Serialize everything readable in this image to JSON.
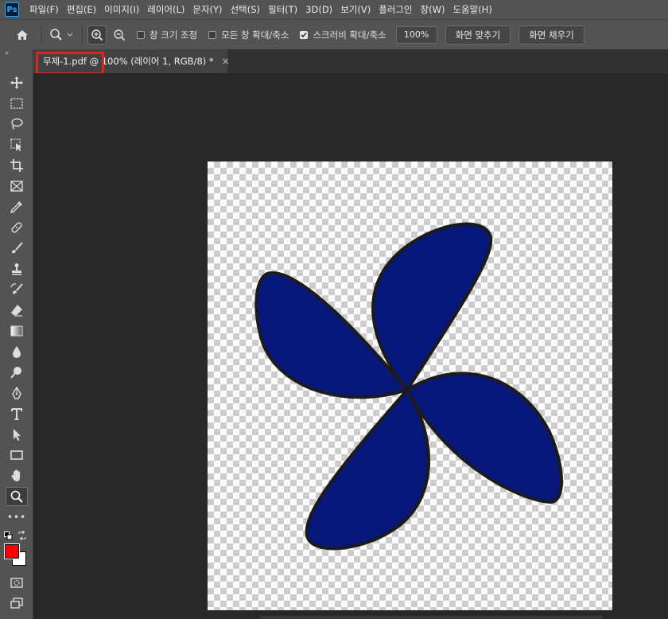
{
  "app": {
    "logo_text": "Ps"
  },
  "menu": [
    "파일(F)",
    "편집(E)",
    "이미지(I)",
    "레이어(L)",
    "문자(Y)",
    "선택(S)",
    "필터(T)",
    "3D(D)",
    "보기(V)",
    "플러그인",
    "창(W)",
    "도움말(H)"
  ],
  "options": {
    "resize_windows_label": "창 크기 조정",
    "zoom_all_windows_label": "모든 창 확대/축소",
    "scrubby_zoom_label": "스크러비 확대/축소",
    "scrubby_zoom_checked": true,
    "zoom_value": "100%",
    "fit_screen_label": "화면 맞추기",
    "fill_screen_label": "화면 채우기"
  },
  "document_tab": {
    "title": "무제-1.pdf @ 100% (레이어 1, RGB/8) *",
    "close_glyph": "×"
  },
  "toolbar": {
    "grip_glyph": "»",
    "more_glyph": "•••"
  },
  "colors": {
    "foreground": "#ff0000",
    "background": "#ffffff",
    "shape_fill": "#08187a",
    "highlight": "#e5231e"
  },
  "icons": [
    "home-icon",
    "zoom-tool-icon",
    "zoom-in-icon",
    "zoom-out-icon",
    "move-tool-icon",
    "marquee-tool-icon",
    "lasso-tool-icon",
    "object-select-tool-icon",
    "crop-tool-icon",
    "frame-tool-icon",
    "eyedropper-tool-icon",
    "healing-brush-icon",
    "brush-tool-icon",
    "clone-stamp-icon",
    "history-brush-icon",
    "eraser-tool-icon",
    "gradient-tool-icon",
    "blur-tool-icon",
    "dodge-tool-icon",
    "pen-tool-icon",
    "type-tool-icon",
    "path-select-icon",
    "rectangle-tool-icon",
    "hand-tool-icon",
    "zoom-tool-icon",
    "more-tools-icon",
    "quick-mask-icon",
    "screen-mode-icon"
  ]
}
